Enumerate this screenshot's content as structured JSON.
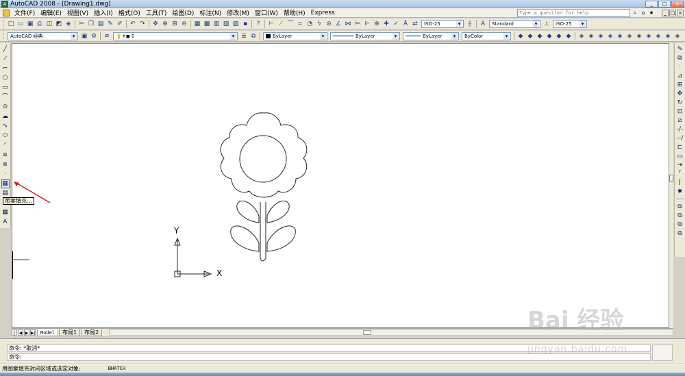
{
  "window": {
    "title": "AutoCAD 2008 - [Drawing1.dwg]",
    "logo_text": "A",
    "controls": [
      "_",
      "□",
      "×"
    ]
  },
  "menu": {
    "items": [
      "文件(F)",
      "编辑(E)",
      "视图(V)",
      "插入(I)",
      "格式(O)",
      "工具(T)",
      "绘图(D)",
      "标注(N)",
      "修改(M)",
      "窗口(W)",
      "帮助(H)",
      "Express"
    ],
    "help_placeholder": "Type a question for help",
    "doc_controls": [
      "_",
      "□",
      "×"
    ]
  },
  "toolbar1": {
    "text_style": "ISO-25",
    "dim_style": "Standard",
    "table_style": "ISO-25"
  },
  "toolbar2": {
    "workspace": "AutoCAD 经典",
    "layer": "0",
    "color": "ByLayer",
    "linetype": "ByLayer",
    "lineweight": "ByLayer",
    "plotstyle": "ByColor"
  },
  "draw_tools": [
    "line-icon",
    "construction-line-icon",
    "polyline-icon",
    "polygon-icon",
    "rectangle-icon",
    "arc-icon",
    "circle-icon",
    "revision-cloud-icon",
    "spline-icon",
    "ellipse-icon",
    "ellipse-arc-icon",
    "insert-block-icon",
    "make-block-icon",
    "point-icon",
    "hatch-icon",
    "gradient-icon",
    "region-icon",
    "table-icon",
    "multiline-text-icon"
  ],
  "modify_tools": [
    "erase-icon",
    "copy-icon",
    "mirror-icon",
    "offset-icon",
    "array-icon",
    "move-icon",
    "rotate-icon",
    "scale-icon",
    "stretch-icon",
    "trim-icon",
    "extend-icon",
    "break-at-point-icon",
    "break-icon",
    "join-icon",
    "chamfer-icon",
    "fillet-icon",
    "explode-icon",
    "draworder-front-icon",
    "draworder-back-icon",
    "draworder-above-icon",
    "draworder-under-icon"
  ],
  "tooltip": "图案填充...",
  "ucs": {
    "x_label": "X",
    "y_label": "Y"
  },
  "layout_tabs": [
    "Model",
    "布局1",
    "布局2"
  ],
  "command": {
    "line1": "命令: *取消*",
    "line2": "命令:"
  },
  "status": {
    "prompt": "用图案填充封闭区域或选定对象:",
    "command": "BHATCH"
  },
  "watermark": {
    "main": "Bai 经验",
    "sub": "jingyan.baidu.com"
  }
}
